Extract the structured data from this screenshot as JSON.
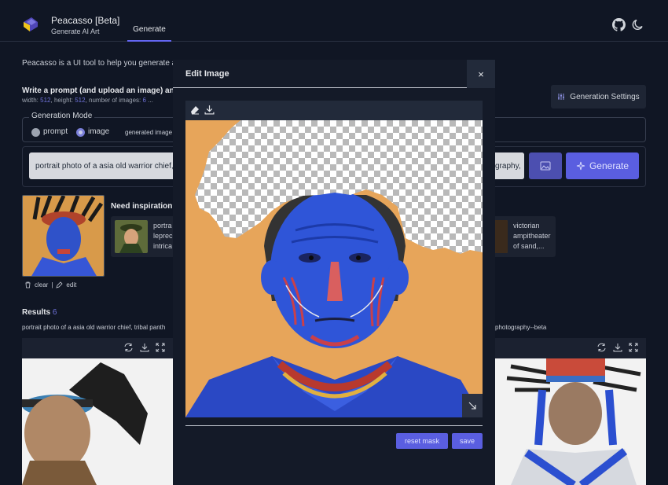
{
  "header": {
    "app_title": "Peacasso [Beta]",
    "app_subtitle": "Generate AI Art",
    "tab_generate": "Generate"
  },
  "intro": "Peacasso is a UI tool to help you generate art",
  "prompt_section": {
    "title": "Write a prompt (and upload an image) and g",
    "dims_width_label": "width:",
    "dims_width": "512",
    "dims_height_label": ", height:",
    "dims_height": "512",
    "dims_images_label": ", number of images:",
    "dims_images": "6",
    "dims_tail": " ..."
  },
  "settings_button": "Generation Settings",
  "generation_mode": {
    "legend": "Generation Mode",
    "option_prompt": "prompt",
    "option_image": "image",
    "selected": "image",
    "generated_image_label": "generated image"
  },
  "prompt_input": {
    "value": "portrait photo of a asia old warrior chief, t",
    "value_tail": "graphy,"
  },
  "generate_button": "Generate",
  "thumbnail_actions": {
    "clear": "clear",
    "separator": "|",
    "edit": "edit"
  },
  "inspiration": {
    "title": "Need inspiration?",
    "cards": [
      {
        "lines": [
          "portra",
          "leprec",
          "intrica"
        ]
      },
      {
        "lines": [
          "victorian",
          "ampitheater",
          "of sand,..."
        ]
      }
    ]
  },
  "results": {
    "title": "Results",
    "count": "6",
    "prompt": "portrait photo of a asia old warrior chief, tribal panth",
    "prompt_tail": "photography--beta"
  },
  "modal": {
    "title": "Edit Image",
    "close": "×",
    "reset_mask": "reset mask",
    "save": "save"
  },
  "colors": {
    "background": "#101624",
    "accent": "#5a5ee0",
    "modal_bg": "#141a28"
  },
  "icons": [
    "logo-icon",
    "github-icon",
    "moon-icon",
    "sliders-icon",
    "image-icon",
    "sparkle-icon",
    "trash-icon",
    "pencil-icon",
    "eraser-icon",
    "download-icon",
    "refresh-icon",
    "expand-icon",
    "close-icon",
    "resize-icon"
  ]
}
